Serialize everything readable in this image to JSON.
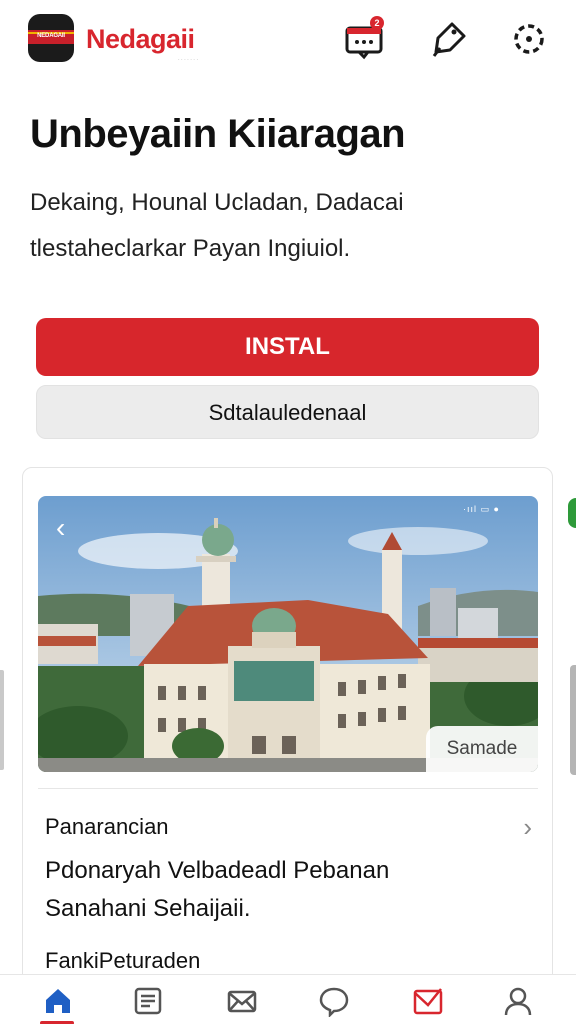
{
  "header": {
    "app_name": "Nedagaii",
    "logo_text": "NEDAGAII",
    "brand_subtext": "· · · · · · ·",
    "notification_count": "2",
    "icons": [
      "chat-notification-icon",
      "tag-icon",
      "settings-icon"
    ]
  },
  "hero": {
    "title": "Unbeyaiin Kiiaragan",
    "description_line1": "Dekaing, Hounal Ucladan, Dadacai",
    "description_line2": "tlestaheclarkar Payan Ingiuiol."
  },
  "buttons": {
    "install_label": "INSTAL",
    "secondary_label": "Sdtalauledenaal"
  },
  "card": {
    "photo_tag": "Samade",
    "photo_status": "·ııl ▭ ●",
    "back_icon": "chevron-left-icon",
    "section_title": "Panarancian",
    "section_body_line1": "Pdonaryah Velbadeadl Pebanan",
    "section_body_line2": "Sanahani Sehaijaii.",
    "section_foot": "FankiPeturaden"
  },
  "bottom_nav": {
    "items": [
      "home-icon",
      "news-icon",
      "mail-icon",
      "chat-icon",
      "inbox-icon",
      "profile-icon"
    ],
    "active_index": 0
  },
  "colors": {
    "accent": "#d8262e",
    "install_bg": "#d7262c",
    "secondary_bg": "#ececec",
    "text": "#111111"
  }
}
